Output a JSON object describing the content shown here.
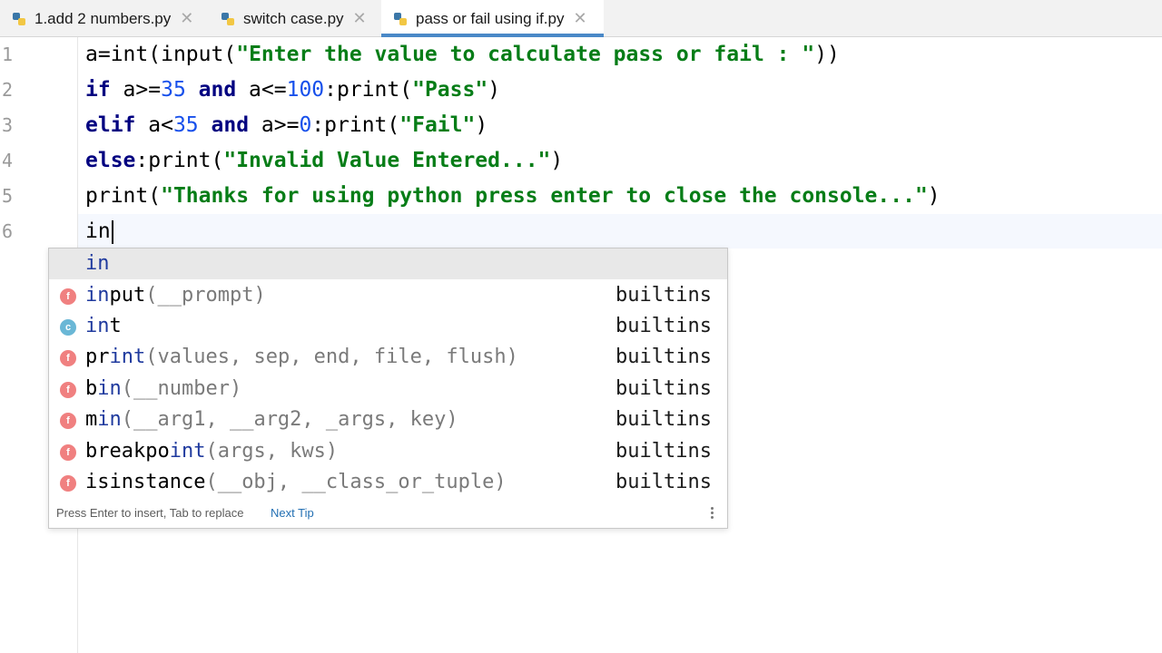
{
  "tabs": [
    {
      "label": "1.add 2 numbers.py",
      "active": false
    },
    {
      "label": "switch case.py",
      "active": false
    },
    {
      "label": "pass or fail using if.py",
      "active": true
    }
  ],
  "gutter": {
    "line_numbers": [
      "1",
      "2",
      "3",
      "4",
      "5",
      "6"
    ]
  },
  "code": {
    "line1": {
      "a": "a=",
      "int": "int",
      "p1": "(",
      "input": "input",
      "p2": "(",
      "str": "\"Enter the value to calculate pass or fail : \"",
      "p3": "))"
    },
    "line2": {
      "if": "if",
      "a1": " a>=",
      "n1": "35",
      "and": "and",
      "a2": " a<=",
      "n2": "100",
      "colon": ":",
      "print": "print",
      "p1": "(",
      "str": "\"Pass\"",
      "p2": ")"
    },
    "line3": {
      "elif": "elif",
      "a1": " a<",
      "n1": "35",
      "and": "and",
      "a2": " a>=",
      "n2": "0",
      "colon": ":",
      "print": "print",
      "p1": "(",
      "str": "\"Fail\"",
      "p2": ")"
    },
    "line4": {
      "else": "else",
      "colon": ":",
      "print": "print",
      "p1": "(",
      "str": "\"Invalid Value Entered...\"",
      "p2": ")"
    },
    "line5": {
      "print": "print",
      "p1": "(",
      "str": "\"Thanks for using python press enter to close the console...\"",
      "p2": ")"
    },
    "line6": {
      "typed": "in"
    }
  },
  "completion": {
    "items": [
      {
        "match": "in",
        "rest": "",
        "sig": "",
        "source": "",
        "badge": "",
        "selected": true
      },
      {
        "match": "in",
        "rest": "put",
        "sig": "(__prompt)",
        "source": "builtins",
        "badge": "f"
      },
      {
        "match": "in",
        "rest": "t",
        "sig": "",
        "source": "builtins",
        "badge": "c"
      },
      {
        "match": "pr",
        "rest": "int",
        "sig": "(values, sep, end, file, flush)",
        "source": "builtins",
        "badge": "f"
      },
      {
        "match": "b",
        "rest": "in",
        "sig": "(__number)",
        "source": "builtins",
        "badge": "f"
      },
      {
        "match": "m",
        "rest": "in",
        "sig": "(__arg1, __arg2, _args, key)",
        "source": "builtins",
        "badge": "f"
      },
      {
        "match": "breakpo",
        "rest": "int",
        "sig": "(args, kws)",
        "source": "builtins",
        "badge": "f"
      },
      {
        "match": "isinstance",
        "rest": "",
        "sig": "(__obj, __class_or_tuple)",
        "source": "builtins",
        "badge": "f"
      }
    ],
    "footer_hint": "Press Enter to insert, Tab to replace",
    "footer_tip": "Next Tip"
  },
  "colors": {
    "accent": "#4a88c7",
    "keyword": "#000080",
    "string": "#067d17",
    "number": "#1750eb"
  }
}
